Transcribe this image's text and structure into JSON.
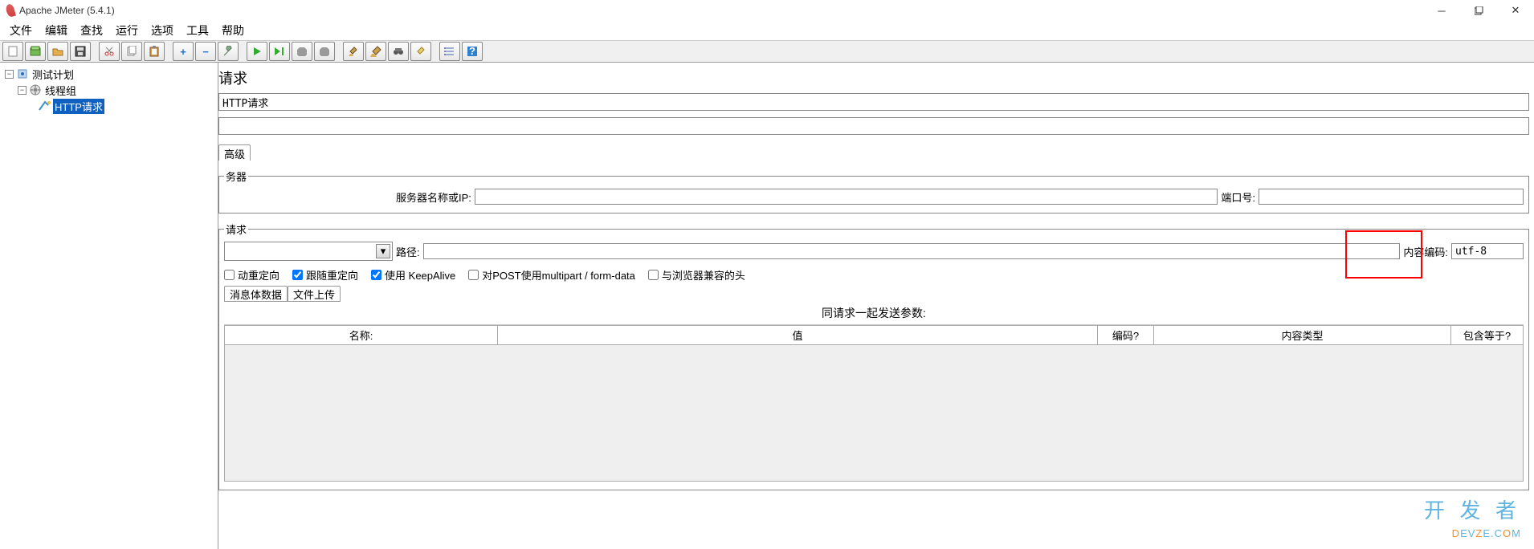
{
  "window": {
    "title": "Apache JMeter (5.4.1)"
  },
  "menu": [
    "文件",
    "编辑",
    "查找",
    "运行",
    "选项",
    "工具",
    "帮助"
  ],
  "tree": {
    "root": "测试计划",
    "thread_group": "线程组",
    "http_request": "HTTP请求"
  },
  "editor": {
    "header": "请求",
    "name_value": "HTTP请求",
    "comment_value": "",
    "tabs": {
      "advanced": "高级"
    },
    "server_section": {
      "legend": "务器",
      "server_label": "服务器名称或IP:",
      "server_value": "",
      "port_label": "端口号:",
      "port_value": ""
    },
    "request_section": {
      "legend": "请求",
      "method_value": "",
      "path_label": "路径:",
      "path_value": "",
      "encoding_label": "内容编码:",
      "encoding_value": "utf-8"
    },
    "checkboxes": {
      "auto_redirect": "动重定向",
      "follow_redirect": "跟随重定向",
      "keepalive": "使用 KeepAlive",
      "multipart": "对POST使用multipart / form-data",
      "browser_compat": "与浏览器兼容的头"
    },
    "sub_tabs": {
      "body": "消息体数据",
      "upload": "文件上传"
    },
    "params": {
      "title": "同请求一起发送参数:",
      "cols": {
        "name": "名称:",
        "value": "值",
        "encode": "编码?",
        "ctype": "内容类型",
        "include": "包含等于?"
      }
    }
  },
  "watermark": {
    "l1": "开 发 者",
    "l2a": "D",
    "l2b": "EV",
    "l2c": "Z",
    "l2d": "E",
    "l2e": ".C",
    "l2f": "O",
    "l2g": "M"
  }
}
